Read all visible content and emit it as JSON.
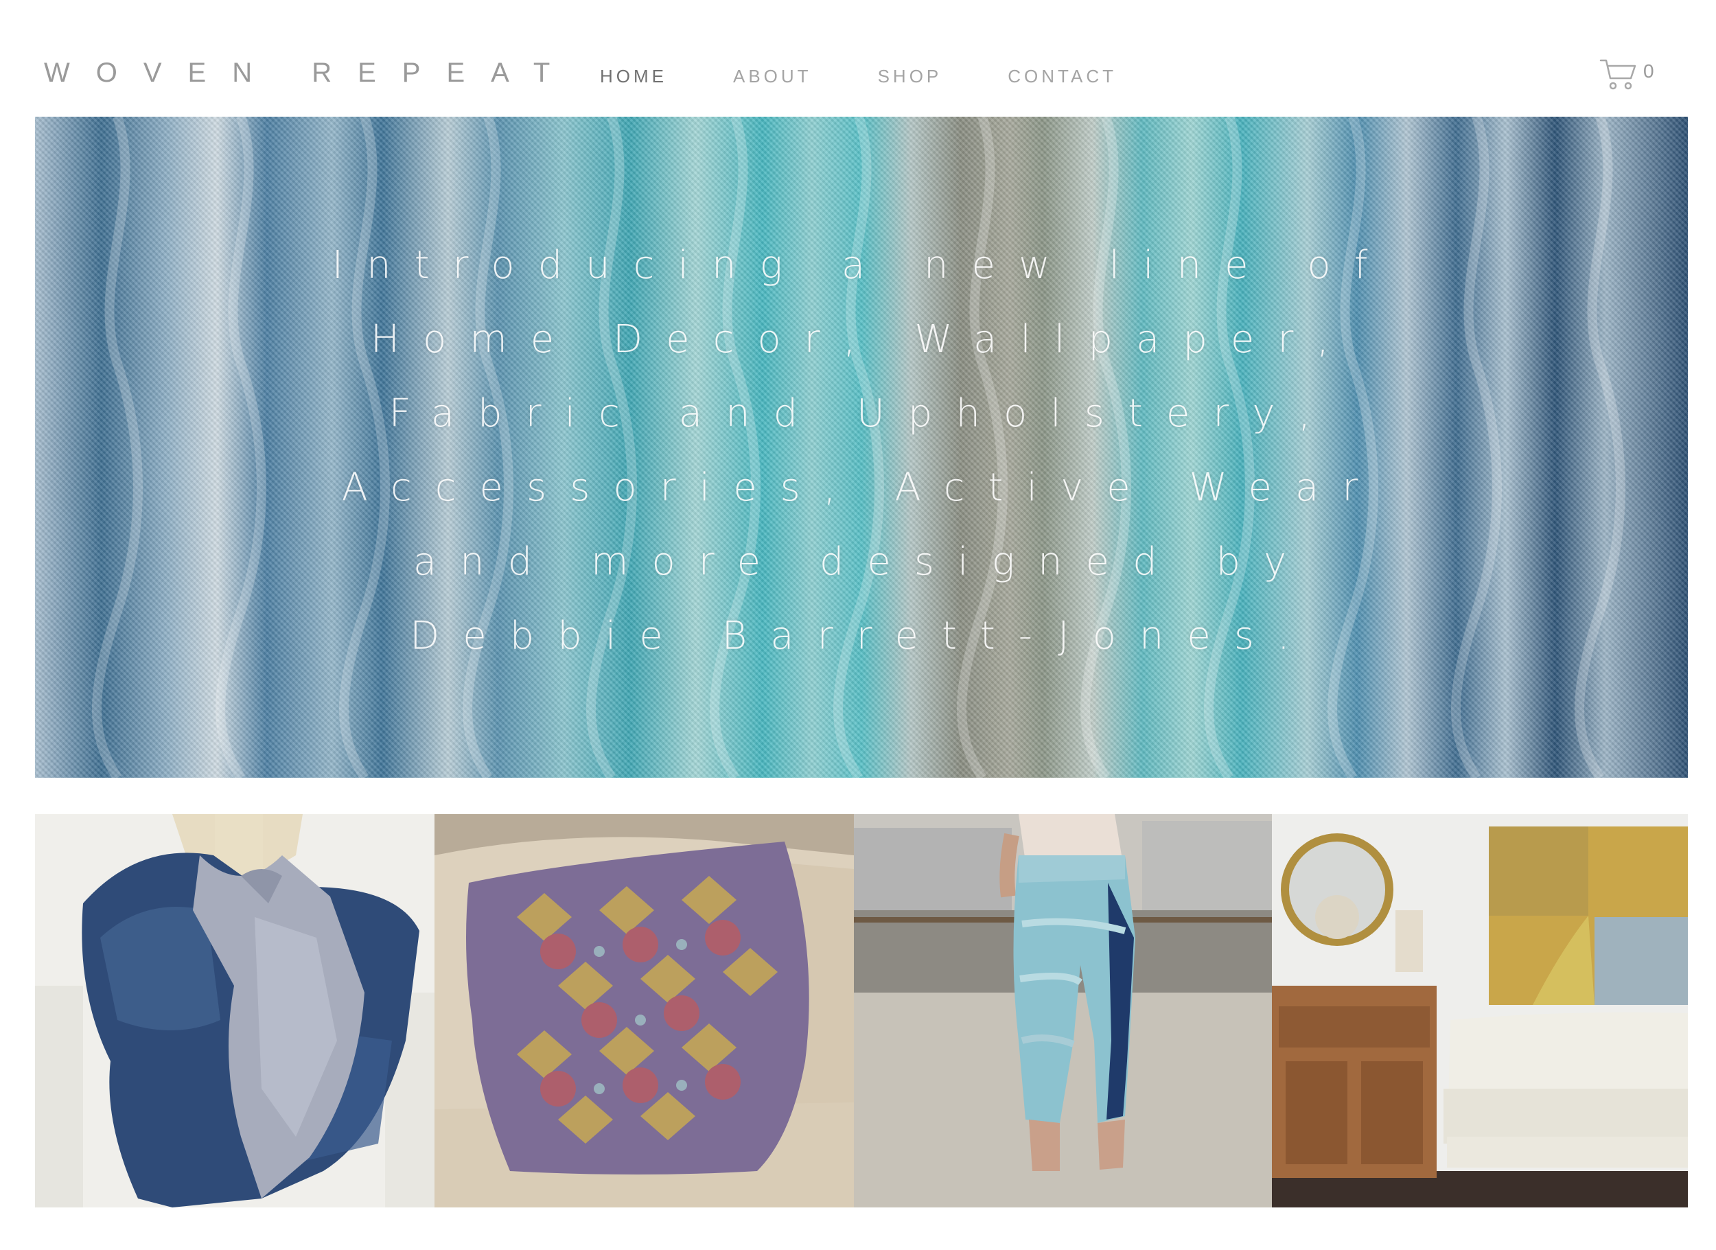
{
  "header": {
    "logo": "WOVEN REPEAT",
    "nav": [
      {
        "label": "HOME",
        "active": true
      },
      {
        "label": "ABOUT",
        "active": false
      },
      {
        "label": "SHOP",
        "active": false
      },
      {
        "label": "CONTACT",
        "active": false
      }
    ],
    "cart": {
      "icon": "cart-icon",
      "count": "0"
    }
  },
  "hero": {
    "lines": [
      "Introducing a new line of",
      "Home Decor, Wallpaper,",
      "Fabric and Upholstery,",
      "Accessories, Active Wear",
      "and more designed by",
      "Debbie Barrett-Jones."
    ]
  },
  "gallery": {
    "tiles": [
      {
        "subject": "scarf-photo"
      },
      {
        "subject": "pillow-photo"
      },
      {
        "subject": "leggings-photo"
      },
      {
        "subject": "room-photo"
      }
    ]
  },
  "colors": {
    "text_muted": "#a4a4a4",
    "text_active": "#707070",
    "background": "#ffffff"
  }
}
